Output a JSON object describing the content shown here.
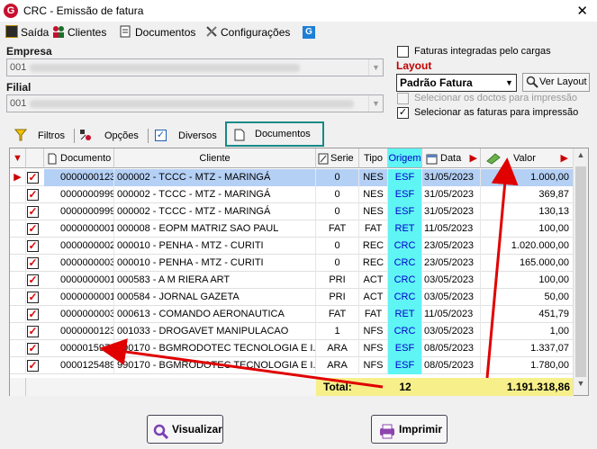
{
  "window": {
    "title": "CRC - Emissão de fatura",
    "close_glyph": "✕"
  },
  "menu": {
    "saida": "Saída",
    "clientes": "Clientes",
    "documentos": "Documentos",
    "configuracoes": "Configurações"
  },
  "empresa": {
    "label": "Empresa",
    "code": "001"
  },
  "filial": {
    "label": "Filial",
    "code": "001"
  },
  "options": {
    "faturas_cargas": "Faturas integradas pelo cargas",
    "layout_label": "Layout",
    "layout_value": "Padrão Fatura",
    "ver_layout": "Ver Layout",
    "selecionar_doctos": "Selecionar os doctos para impressão",
    "selecionar_faturas": "Selecionar as faturas para impressão"
  },
  "tabs": [
    "Filtros",
    "Opções",
    "Diversos",
    "Documentos"
  ],
  "grid": {
    "headers": {
      "documento": "Documento",
      "cliente": "Cliente",
      "serie": "Serie",
      "tipo": "Tipo",
      "origem": "Origem",
      "data": "Data",
      "valor": "Valor"
    },
    "rows": [
      {
        "doc": "0000000123",
        "cliente": "000002 - TCCC - MTZ - MARINGÁ",
        "serie": "0",
        "tipo": "NES",
        "origem": "ESF",
        "data": "31/05/2023",
        "valor": "1.000,00"
      },
      {
        "doc": "0000000999",
        "cliente": "000002 - TCCC - MTZ - MARINGÁ",
        "serie": "0",
        "tipo": "NES",
        "origem": "ESF",
        "data": "31/05/2023",
        "valor": "369,87"
      },
      {
        "doc": "0000000999",
        "cliente": "000002 - TCCC - MTZ - MARINGÁ",
        "serie": "0",
        "tipo": "NES",
        "origem": "ESF",
        "data": "31/05/2023",
        "valor": "130,13"
      },
      {
        "doc": "0000000001",
        "cliente": "000008 - EOPM MATRIZ SAO PAUL",
        "serie": "FAT",
        "tipo": "FAT",
        "origem": "RET",
        "data": "11/05/2023",
        "valor": "100,00"
      },
      {
        "doc": "0000000002",
        "cliente": "000010 - PENHA - MTZ - CURITI",
        "serie": "0",
        "tipo": "REC",
        "origem": "CRC",
        "data": "23/05/2023",
        "valor": "1.020.000,00"
      },
      {
        "doc": "0000000003",
        "cliente": "000010 - PENHA - MTZ - CURITI",
        "serie": "0",
        "tipo": "REC",
        "origem": "CRC",
        "data": "23/05/2023",
        "valor": "165.000,00"
      },
      {
        "doc": "0000000001",
        "cliente": "000583 - A M RIERA ART",
        "serie": "PRI",
        "tipo": "ACT",
        "origem": "CRC",
        "data": "03/05/2023",
        "valor": "100,00"
      },
      {
        "doc": "0000000001",
        "cliente": "000584 - JORNAL GAZETA",
        "serie": "PRI",
        "tipo": "ACT",
        "origem": "CRC",
        "data": "03/05/2023",
        "valor": "50,00"
      },
      {
        "doc": "0000000003",
        "cliente": "000613 - COMANDO AERONAUTICA",
        "serie": "FAT",
        "tipo": "FAT",
        "origem": "RET",
        "data": "11/05/2023",
        "valor": "451,79"
      },
      {
        "doc": "0000000123",
        "cliente": "001033 - DROGAVET MANIPULACAO",
        "serie": "1",
        "tipo": "NFS",
        "origem": "CRC",
        "data": "03/05/2023",
        "valor": "1,00"
      },
      {
        "doc": "0000015978",
        "cliente": "990170 - BGMRODOTEC TECNOLOGIA E I...",
        "serie": "ARA",
        "tipo": "NFS",
        "origem": "ESF",
        "data": "08/05/2023",
        "valor": "1.337,07"
      },
      {
        "doc": "0000125489",
        "cliente": "990170 - BGMRODOTEC TECNOLOGIA E I...",
        "serie": "ARA",
        "tipo": "NFS",
        "origem": "ESF",
        "data": "08/05/2023",
        "valor": "1.780,00"
      }
    ],
    "total_label": "Total:",
    "total_count": "12",
    "total_value": "1.191.318,86"
  },
  "buttons": {
    "visualizar": "Visualizar",
    "imprimir": "Imprimir"
  },
  "colors": {
    "accent_red": "#c00000",
    "origem_cyan": "#5ff5f5",
    "tab_highlight": "#168a87",
    "total_yellow": "#f7f08a"
  }
}
